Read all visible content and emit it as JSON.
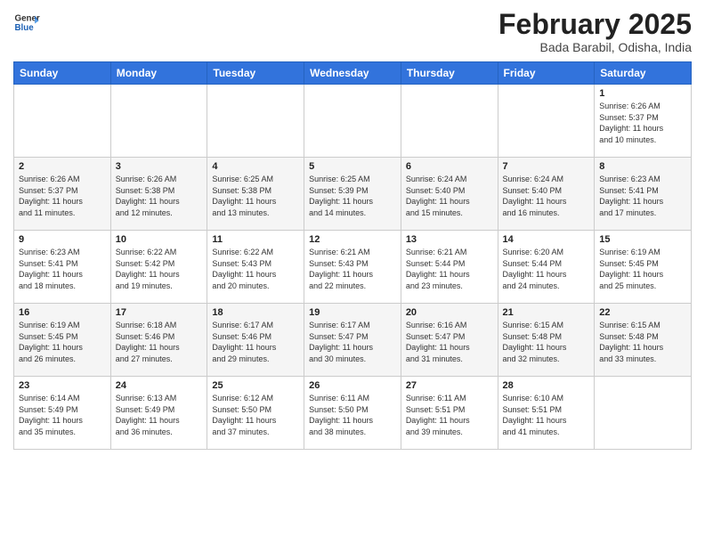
{
  "logo": {
    "general": "General",
    "blue": "Blue"
  },
  "header": {
    "month_year": "February 2025",
    "location": "Bada Barabil, Odisha, India"
  },
  "weekdays": [
    "Sunday",
    "Monday",
    "Tuesday",
    "Wednesday",
    "Thursday",
    "Friday",
    "Saturday"
  ],
  "weeks": [
    [
      {
        "day": "",
        "info": ""
      },
      {
        "day": "",
        "info": ""
      },
      {
        "day": "",
        "info": ""
      },
      {
        "day": "",
        "info": ""
      },
      {
        "day": "",
        "info": ""
      },
      {
        "day": "",
        "info": ""
      },
      {
        "day": "1",
        "info": "Sunrise: 6:26 AM\nSunset: 5:37 PM\nDaylight: 11 hours\nand 10 minutes."
      }
    ],
    [
      {
        "day": "2",
        "info": "Sunrise: 6:26 AM\nSunset: 5:37 PM\nDaylight: 11 hours\nand 11 minutes."
      },
      {
        "day": "3",
        "info": "Sunrise: 6:26 AM\nSunset: 5:38 PM\nDaylight: 11 hours\nand 12 minutes."
      },
      {
        "day": "4",
        "info": "Sunrise: 6:25 AM\nSunset: 5:38 PM\nDaylight: 11 hours\nand 13 minutes."
      },
      {
        "day": "5",
        "info": "Sunrise: 6:25 AM\nSunset: 5:39 PM\nDaylight: 11 hours\nand 14 minutes."
      },
      {
        "day": "6",
        "info": "Sunrise: 6:24 AM\nSunset: 5:40 PM\nDaylight: 11 hours\nand 15 minutes."
      },
      {
        "day": "7",
        "info": "Sunrise: 6:24 AM\nSunset: 5:40 PM\nDaylight: 11 hours\nand 16 minutes."
      },
      {
        "day": "8",
        "info": "Sunrise: 6:23 AM\nSunset: 5:41 PM\nDaylight: 11 hours\nand 17 minutes."
      }
    ],
    [
      {
        "day": "9",
        "info": "Sunrise: 6:23 AM\nSunset: 5:41 PM\nDaylight: 11 hours\nand 18 minutes."
      },
      {
        "day": "10",
        "info": "Sunrise: 6:22 AM\nSunset: 5:42 PM\nDaylight: 11 hours\nand 19 minutes."
      },
      {
        "day": "11",
        "info": "Sunrise: 6:22 AM\nSunset: 5:43 PM\nDaylight: 11 hours\nand 20 minutes."
      },
      {
        "day": "12",
        "info": "Sunrise: 6:21 AM\nSunset: 5:43 PM\nDaylight: 11 hours\nand 22 minutes."
      },
      {
        "day": "13",
        "info": "Sunrise: 6:21 AM\nSunset: 5:44 PM\nDaylight: 11 hours\nand 23 minutes."
      },
      {
        "day": "14",
        "info": "Sunrise: 6:20 AM\nSunset: 5:44 PM\nDaylight: 11 hours\nand 24 minutes."
      },
      {
        "day": "15",
        "info": "Sunrise: 6:19 AM\nSunset: 5:45 PM\nDaylight: 11 hours\nand 25 minutes."
      }
    ],
    [
      {
        "day": "16",
        "info": "Sunrise: 6:19 AM\nSunset: 5:45 PM\nDaylight: 11 hours\nand 26 minutes."
      },
      {
        "day": "17",
        "info": "Sunrise: 6:18 AM\nSunset: 5:46 PM\nDaylight: 11 hours\nand 27 minutes."
      },
      {
        "day": "18",
        "info": "Sunrise: 6:17 AM\nSunset: 5:46 PM\nDaylight: 11 hours\nand 29 minutes."
      },
      {
        "day": "19",
        "info": "Sunrise: 6:17 AM\nSunset: 5:47 PM\nDaylight: 11 hours\nand 30 minutes."
      },
      {
        "day": "20",
        "info": "Sunrise: 6:16 AM\nSunset: 5:47 PM\nDaylight: 11 hours\nand 31 minutes."
      },
      {
        "day": "21",
        "info": "Sunrise: 6:15 AM\nSunset: 5:48 PM\nDaylight: 11 hours\nand 32 minutes."
      },
      {
        "day": "22",
        "info": "Sunrise: 6:15 AM\nSunset: 5:48 PM\nDaylight: 11 hours\nand 33 minutes."
      }
    ],
    [
      {
        "day": "23",
        "info": "Sunrise: 6:14 AM\nSunset: 5:49 PM\nDaylight: 11 hours\nand 35 minutes."
      },
      {
        "day": "24",
        "info": "Sunrise: 6:13 AM\nSunset: 5:49 PM\nDaylight: 11 hours\nand 36 minutes."
      },
      {
        "day": "25",
        "info": "Sunrise: 6:12 AM\nSunset: 5:50 PM\nDaylight: 11 hours\nand 37 minutes."
      },
      {
        "day": "26",
        "info": "Sunrise: 6:11 AM\nSunset: 5:50 PM\nDaylight: 11 hours\nand 38 minutes."
      },
      {
        "day": "27",
        "info": "Sunrise: 6:11 AM\nSunset: 5:51 PM\nDaylight: 11 hours\nand 39 minutes."
      },
      {
        "day": "28",
        "info": "Sunrise: 6:10 AM\nSunset: 5:51 PM\nDaylight: 11 hours\nand 41 minutes."
      },
      {
        "day": "",
        "info": ""
      }
    ]
  ]
}
